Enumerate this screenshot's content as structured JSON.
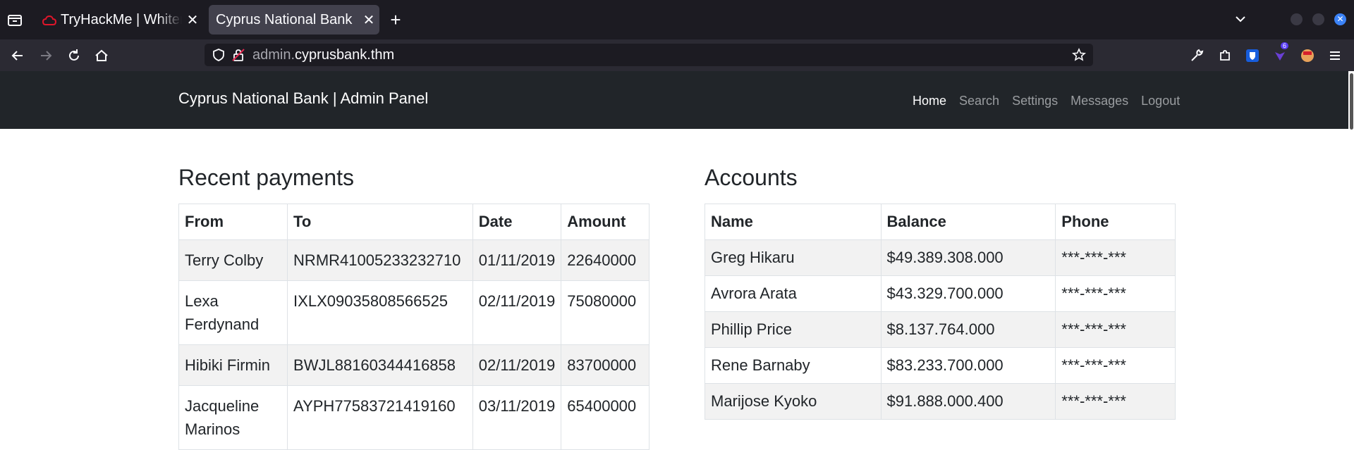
{
  "browser": {
    "tabs": [
      {
        "title": "TryHackMe | Whiterose",
        "active": false
      },
      {
        "title": "Cyprus National Bank",
        "active": true
      }
    ],
    "url_prefix": "admin.",
    "url_domain": "cyprusbank.thm",
    "extension_badge": "6"
  },
  "site": {
    "brand": "Cyprus National Bank | Admin Panel",
    "nav": [
      "Home",
      "Search",
      "Settings",
      "Messages",
      "Logout"
    ]
  },
  "payments": {
    "title": "Recent payments",
    "columns": [
      "From",
      "To",
      "Date",
      "Amount"
    ],
    "rows": [
      {
        "from": "Terry Colby",
        "to": "NRMR41005233232710",
        "date": "01/11/2019",
        "amount": "22640000"
      },
      {
        "from": "Lexa Ferdynand",
        "to": "IXLX09035808566525",
        "date": "02/11/2019",
        "amount": "75080000"
      },
      {
        "from": "Hibiki Firmin",
        "to": "BWJL88160344416858",
        "date": "02/11/2019",
        "amount": "83700000"
      },
      {
        "from": "Jacqueline Marinos",
        "to": "AYPH77583721419160",
        "date": "03/11/2019",
        "amount": "65400000"
      }
    ]
  },
  "accounts": {
    "title": "Accounts",
    "columns": [
      "Name",
      "Balance",
      "Phone"
    ],
    "rows": [
      {
        "name": "Greg Hikaru",
        "balance": "$49.389.308.000",
        "phone": "***-***-***"
      },
      {
        "name": "Avrora Arata",
        "balance": "$43.329.700.000",
        "phone": "***-***-***"
      },
      {
        "name": "Phillip Price",
        "balance": "$8.137.764.000",
        "phone": "***-***-***"
      },
      {
        "name": "Rene Barnaby",
        "balance": "$83.233.700.000",
        "phone": "***-***-***"
      },
      {
        "name": "Marijose Kyoko",
        "balance": "$91.888.000.400",
        "phone": "***-***-***"
      }
    ]
  }
}
